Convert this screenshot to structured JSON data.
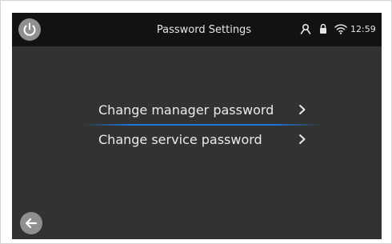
{
  "header": {
    "title": "Password Settings",
    "time": "12:59",
    "icons": [
      "power-icon",
      "user-icon",
      "lock-icon",
      "wifi-icon"
    ]
  },
  "menu": {
    "items": [
      {
        "label": "Change manager password",
        "icon": "chevron-right-icon"
      },
      {
        "label": "Change service password",
        "icon": "chevron-right-icon"
      }
    ]
  },
  "footer": {
    "back_icon": "back-arrow-icon"
  },
  "colors": {
    "screen_bg": "#323232",
    "statusbar_bg": "#121212",
    "button_bg": "#8f8f8f",
    "accent": "#1e78dc",
    "text": "#eaeaea"
  }
}
